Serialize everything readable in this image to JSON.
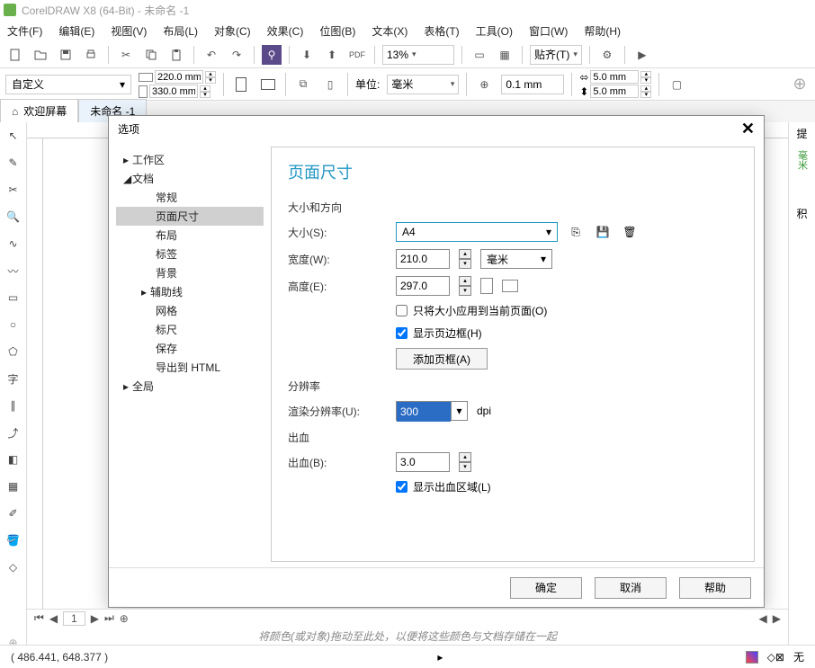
{
  "app": {
    "title": "CorelDRAW X8 (64-Bit) - 未命名 -1"
  },
  "menu": [
    "文件(F)",
    "编辑(E)",
    "视图(V)",
    "布局(L)",
    "对象(C)",
    "效果(C)",
    "位图(B)",
    "文本(X)",
    "表格(T)",
    "工具(O)",
    "窗口(W)",
    "帮助(H)"
  ],
  "toolbar": {
    "zoom": "13%",
    "snap_label": "贴齐(T)"
  },
  "propbar": {
    "preset": "自定义",
    "width": "220.0 mm",
    "height": "330.0 mm",
    "units_label": "单位:",
    "units": "毫米",
    "nudge": "0.1 mm",
    "dup_x": "5.0 mm",
    "dup_y": "5.0 mm"
  },
  "tabs": {
    "welcome": "欢迎屏幕",
    "doc": "未命名 -1"
  },
  "right_docker": {
    "hint": "提",
    "ruler_unit": "毫米"
  },
  "dialog": {
    "title": "选项",
    "tree": {
      "workspace": "工作区",
      "document": "文档",
      "general": "常规",
      "page_size": "页面尺寸",
      "layout": "布局",
      "label": "标签",
      "background": "背景",
      "guidelines": "辅助线",
      "grid": "网格",
      "rulers": "标尺",
      "save": "保存",
      "export_html": "导出到 HTML",
      "global": "全局"
    },
    "content": {
      "heading": "页面尺寸",
      "section_size": "大小和方向",
      "size_label": "大小(S):",
      "size_value": "A4",
      "width_label": "宽度(W):",
      "width_value": "210.0",
      "width_units": "毫米",
      "height_label": "高度(E):",
      "height_value": "297.0",
      "apply_current": "只将大小应用到当前页面(O)",
      "show_border": "显示页边框(H)",
      "add_frame": "添加页框(A)",
      "section_res": "分辨率",
      "render_res_label": "渲染分辨率(U):",
      "render_res_value": "300",
      "dpi": "dpi",
      "section_bleed": "出血",
      "bleed_label": "出血(B):",
      "bleed_value": "3.0",
      "show_bleed": "显示出血区域(L)"
    },
    "buttons": {
      "ok": "确定",
      "cancel": "取消",
      "help": "帮助"
    }
  },
  "pagebar": {
    "page": "1"
  },
  "colorbar": {
    "hint": "将颜色(或对象)拖动至此处，以便将这些颜色与文档存储在一起"
  },
  "status": {
    "coords": "( 486.441, 648.377 )",
    "fill": "无"
  }
}
